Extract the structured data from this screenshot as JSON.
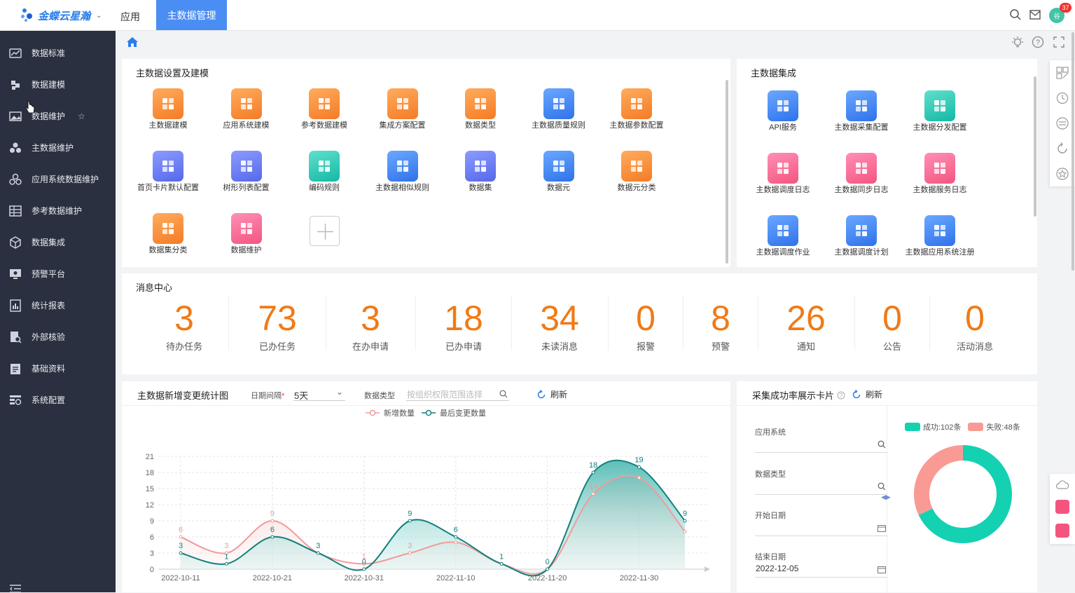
{
  "topbar": {
    "logo_text": "金蝶云星瀚",
    "nav_app": "应用",
    "nav_active": "主数据管理",
    "badge_count": "37",
    "avatar_text": "谷"
  },
  "sidebar": {
    "items": [
      {
        "label": "数据标准",
        "icon": "chart-icon"
      },
      {
        "label": "数据建模",
        "icon": "puzzle-icon"
      },
      {
        "label": "数据维护",
        "icon": "image-icon"
      },
      {
        "label": "主数据维护",
        "icon": "blocks-icon"
      },
      {
        "label": "应用系统数据维护",
        "icon": "blocks-icon"
      },
      {
        "label": "参考数据维护",
        "icon": "grid-icon"
      },
      {
        "label": "数据集成",
        "icon": "cube-icon"
      },
      {
        "label": "预警平台",
        "icon": "monitor-icon"
      },
      {
        "label": "统计报表",
        "icon": "report-icon"
      },
      {
        "label": "外部核验",
        "icon": "doc-search-icon"
      },
      {
        "label": "基础资料",
        "icon": "clipboard-icon"
      },
      {
        "label": "系统配置",
        "icon": "settings-list-icon"
      }
    ]
  },
  "setup_card": {
    "title": "主数据设置及建模",
    "tiles": [
      {
        "label": "主数据建模",
        "color": "orange"
      },
      {
        "label": "应用系统建模",
        "color": "orange"
      },
      {
        "label": "参考数据建模",
        "color": "orange"
      },
      {
        "label": "集成方案配置",
        "color": "orange"
      },
      {
        "label": "数据类型",
        "color": "orange"
      },
      {
        "label": "主数据质量规则",
        "color": "blue"
      },
      {
        "label": "主数据参数配置",
        "color": "orange"
      },
      {
        "label": "首页卡片默认配置",
        "color": "purple"
      },
      {
        "label": "树形列表配置",
        "color": "purple"
      },
      {
        "label": "编码规则",
        "color": "teal"
      },
      {
        "label": "主数据相似规则",
        "color": "blue"
      },
      {
        "label": "数据集",
        "color": "purple"
      },
      {
        "label": "数据元",
        "color": "blue"
      },
      {
        "label": "数据元分类",
        "color": "orange"
      },
      {
        "label": "数据集分类",
        "color": "orange"
      },
      {
        "label": "数据维护",
        "color": "pink"
      }
    ]
  },
  "integration_card": {
    "title": "主数据集成",
    "tiles": [
      {
        "label": "API服务",
        "color": "blue"
      },
      {
        "label": "主数据采集配置",
        "color": "blue"
      },
      {
        "label": "主数据分发配置",
        "color": "teal"
      },
      {
        "label": "主数据调度日志",
        "color": "pink"
      },
      {
        "label": "主数据同步日志",
        "color": "pink"
      },
      {
        "label": "主数据服务日志",
        "color": "pink"
      },
      {
        "label": "主数据调度作业",
        "color": "blue"
      },
      {
        "label": "主数据调度计划",
        "color": "blue"
      },
      {
        "label": "主数据应用系统注册",
        "color": "blue"
      }
    ]
  },
  "message_center": {
    "title": "消息中心",
    "items": [
      {
        "value": "3",
        "label": "待办任务"
      },
      {
        "value": "73",
        "label": "已办任务"
      },
      {
        "value": "3",
        "label": "在办申请"
      },
      {
        "value": "18",
        "label": "已办申请"
      },
      {
        "value": "34",
        "label": "未读消息"
      },
      {
        "value": "0",
        "label": "报警"
      },
      {
        "value": "8",
        "label": "预警"
      },
      {
        "value": "26",
        "label": "通知"
      },
      {
        "value": "0",
        "label": "公告"
      },
      {
        "value": "0",
        "label": "活动消息"
      }
    ]
  },
  "chart_card": {
    "title": "主数据新增变更统计图",
    "interval_label": "日期间隔",
    "interval_value": "5天",
    "type_label": "数据类型",
    "type_placeholder": "按组织权限范围选择",
    "refresh_label": "刷新"
  },
  "chart_data": {
    "type": "area",
    "x": [
      "2022-10-11",
      "2022-10-16",
      "2022-10-21",
      "2022-10-26",
      "2022-10-31",
      "2022-11-05",
      "2022-11-10",
      "2022-11-15",
      "2022-11-20",
      "2022-11-25",
      "2022-11-30",
      "2022-12-05"
    ],
    "x_ticks": [
      "2022-10-11",
      "2022-10-21",
      "2022-10-31",
      "2022-11-10",
      "2022-11-20",
      "2022-11-30"
    ],
    "series": [
      {
        "name": "新增数量",
        "color": "#f19b9b",
        "values": [
          6,
          3,
          9,
          3,
          1,
          3,
          5,
          1,
          0,
          14,
          17,
          7
        ]
      },
      {
        "name": "最后变更数量",
        "color": "#14807d",
        "values": [
          3,
          1,
          6,
          3,
          0,
          9,
          6,
          1,
          0,
          18,
          19,
          9
        ]
      }
    ],
    "labels": [
      {
        "series": 0,
        "points": [
          [
            0,
            "6"
          ],
          [
            1,
            "3"
          ],
          [
            2,
            "9"
          ],
          [
            4,
            "1"
          ],
          [
            5,
            "3"
          ],
          [
            9,
            "14"
          ]
        ]
      },
      {
        "series": 1,
        "points": [
          [
            0,
            "3"
          ],
          [
            1,
            "1"
          ],
          [
            2,
            "6"
          ],
          [
            3,
            "3"
          ],
          [
            4,
            "0"
          ],
          [
            5,
            "9"
          ],
          [
            6,
            "6"
          ],
          [
            7,
            "1"
          ],
          [
            8,
            "0"
          ],
          [
            9,
            "18"
          ],
          [
            10,
            "19"
          ],
          [
            11,
            "9"
          ]
        ]
      }
    ],
    "ylim": [
      0,
      21
    ],
    "yticks": [
      0,
      3,
      6,
      9,
      12,
      15,
      18,
      21
    ],
    "grid": true,
    "legend": "top"
  },
  "success_card": {
    "title": "采集成功率展示卡片",
    "refresh_label": "刷新",
    "fields": [
      {
        "label": "应用系统",
        "value": "",
        "icon": "search-icon"
      },
      {
        "label": "数据类型",
        "value": "",
        "icon": "search-icon"
      },
      {
        "label": "开始日期",
        "value": "",
        "icon": "calendar-icon"
      },
      {
        "label": "结束日期",
        "value": "2022-12-05",
        "icon": "calendar-icon"
      }
    ],
    "legend_success": "成功:102条",
    "legend_fail": "失败:48条"
  },
  "donut_data": {
    "type": "pie",
    "slices": [
      {
        "name": "成功",
        "value": 102,
        "color": "#14d1b2"
      },
      {
        "name": "失败",
        "value": 48,
        "color": "#f99b94"
      }
    ]
  }
}
